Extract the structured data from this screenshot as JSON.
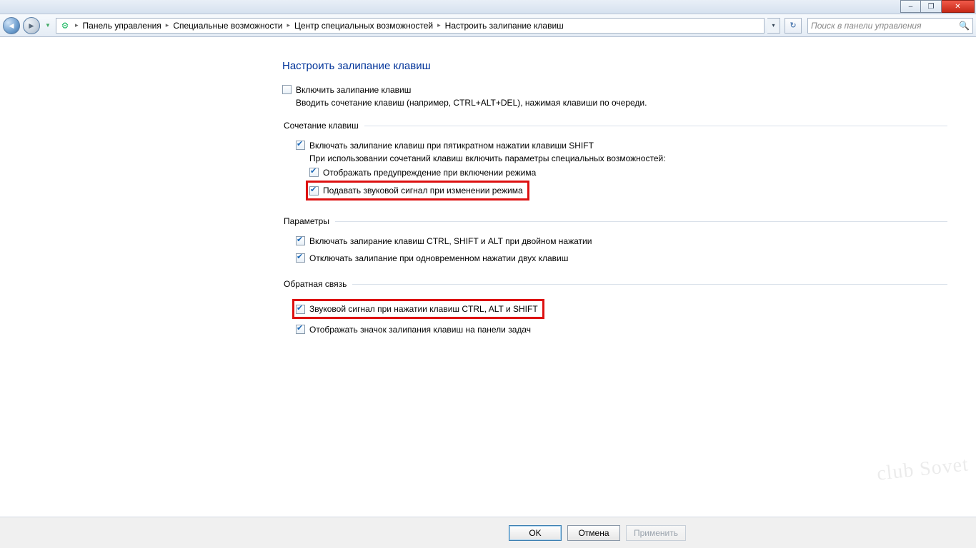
{
  "window_buttons": {
    "min": "–",
    "max": "❐",
    "close": "✕"
  },
  "breadcrumb": {
    "items": [
      "Панель управления",
      "Специальные возможности",
      "Центр специальных возможностей",
      "Настроить залипание клавиш"
    ]
  },
  "search": {
    "placeholder": "Поиск в панели управления"
  },
  "page": {
    "title": "Настроить залипание клавиш",
    "enable_label": "Включить залипание клавиш",
    "enable_desc": "Вводить сочетание клавиш (например, CTRL+ALT+DEL), нажимая клавиши по очереди."
  },
  "group_shortcut": {
    "title": "Сочетание клавиш",
    "opt_shift5": "Включать залипание клавиш при пятикратном нажатии клавиши SHIFT",
    "sub_desc": "При использовании сочетаний клавиш включить параметры специальных возможностей:",
    "opt_warn": "Отображать предупреждение при включении режима",
    "opt_sound": "Подавать звуковой сигнал при изменении режима"
  },
  "group_params": {
    "title": "Параметры",
    "opt_lock": "Включать запирание клавиш CTRL, SHIFT и ALT при двойном нажатии",
    "opt_off2": "Отключать залипание при одновременном нажатии двух клавиш"
  },
  "group_feedback": {
    "title": "Обратная связь",
    "opt_beep": "Звуковой сигнал при нажатии клавиш CTRL, ALT и SHIFT",
    "opt_tray": "Отображать значок залипания клавиш на панели задач"
  },
  "footer": {
    "ok": "OK",
    "cancel": "Отмена",
    "apply": "Применить"
  },
  "watermark": "club Sovet"
}
